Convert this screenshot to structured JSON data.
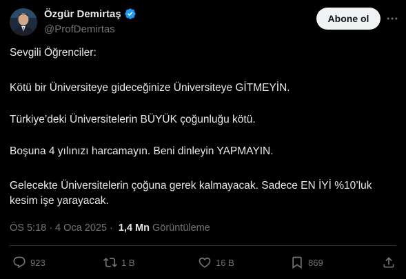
{
  "author": {
    "name": "Özgür Demirtaş",
    "handle": "@ProfDemirtas"
  },
  "follow_button": "Abone ol",
  "tweet": {
    "lines": [
      "Sevgili Öğrenciler:",
      "Kötü bir Üniversiteye gideceğinize Üniversiteye GİTMEYİN.",
      "Türkiye’deki Üniversitelerin BÜYÜK çoğunluğu kötü.",
      "Boşuna 4 yılınızı harcamayın. Beni dinleyin YAPMAYIN.",
      "Gelecekte Üniversitelerin çoğuna gerek kalmayacak. Sadece EN İYİ %10’luk kesim işe yarayacak."
    ]
  },
  "meta": {
    "time": "ÖS 5:18",
    "separator": "·",
    "date": "4 Oca 2025",
    "views_count": "1,4 Mn",
    "views_label": "Görüntüleme"
  },
  "actions": {
    "replies": "923",
    "reposts": "1 B",
    "likes": "16 B",
    "bookmarks": "869"
  },
  "colors": {
    "background": "#000000",
    "text": "#e7e9ea",
    "muted": "#71767b",
    "verified": "#1d9bf0",
    "button_bg": "#eff3f4"
  }
}
